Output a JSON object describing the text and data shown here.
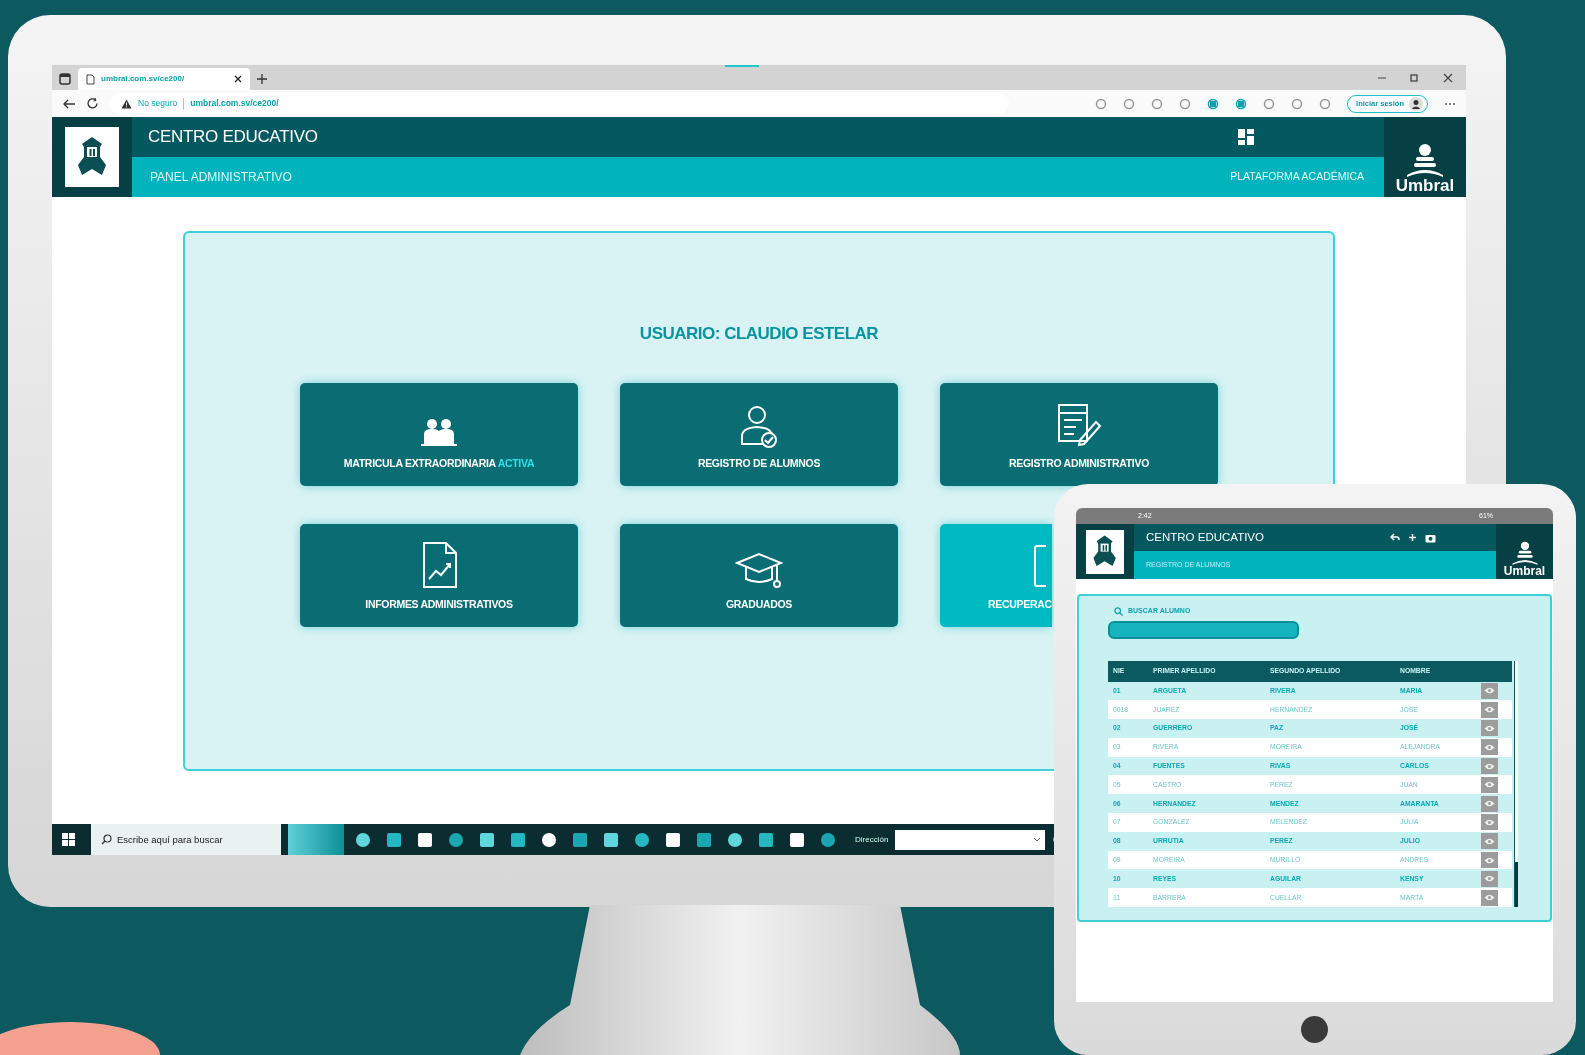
{
  "browser": {
    "tab_title": "umbral.com.sv/ce200/",
    "security": "No seguro",
    "url": "umbral.com.sv/ce200/",
    "sign_in": "Iniciar sesión"
  },
  "header": {
    "title": "CENTRO EDUCATIVO",
    "subtitle": "PANEL ADMINISTRATIVO",
    "platform": "PLATAFORMA ACADÉMICA",
    "brand": "Umbral"
  },
  "user": "USUARIO: CLAUDIO ESTELAR",
  "tiles": [
    {
      "kind": "people",
      "label": "MATRICULA EXTRAORDINARIA",
      "status": "ACTIVA",
      "highlighted": false,
      "clipped": false
    },
    {
      "kind": "user",
      "label": "REGISTRO DE ALUMNOS",
      "highlighted": false,
      "clipped": false
    },
    {
      "kind": "form",
      "label": "REGISTRO ADMINISTRATIVO",
      "highlighted": false,
      "clipped": false
    },
    {
      "kind": "report",
      "label": "INFORMES ADMINISTRATIVOS",
      "highlighted": false,
      "clipped": false
    },
    {
      "kind": "graduation",
      "label": "GRADUADOS",
      "highlighted": false,
      "clipped": false
    },
    {
      "kind": "document",
      "label": "RECUPERAC",
      "highlighted": true,
      "clipped": true
    }
  ],
  "taskbar": {
    "search": {
      "placeholder": "Escribe aquí para buscar"
    },
    "address_label": "Dirección"
  },
  "tablet": {
    "status_time": "2:42",
    "battery": "61%",
    "title": "CENTRO EDUCATIVO",
    "subtitle": "REGISTRO DE ALUMNOS",
    "brand": "Umbral",
    "search_label": "BUSCAR ALUMNO",
    "table": {
      "columns": [
        "NIE",
        "PRIMER APELLIDO",
        "SEGUNDO APELLIDO",
        "NOMBRE"
      ],
      "rows": [
        [
          "01",
          "ARGUETA",
          "RIVERA",
          "MARIA"
        ],
        [
          "0018",
          "JUAREZ",
          "HERNANDEZ",
          "JOSE"
        ],
        [
          "02",
          "GUERRERO",
          "PAZ",
          "JOSÉ"
        ],
        [
          "03",
          "RIVERA",
          "MOREIRA",
          "ALEJANDRA"
        ],
        [
          "04",
          "FUENTES",
          "RIVAS",
          "CARLOS"
        ],
        [
          "05",
          "CASTRO",
          "PEREZ",
          "JUAN"
        ],
        [
          "06",
          "HERNANDEZ",
          "MENDEZ",
          "AMARANTA"
        ],
        [
          "07",
          "GONZALEZ",
          "MELENDEZ",
          "JULIA"
        ],
        [
          "08",
          "URRUTIA",
          "PEREZ",
          "JULIO"
        ],
        [
          "09",
          "MOREIRA",
          "MURILLO",
          "ANDRES"
        ],
        [
          "10",
          "REYES",
          "AGUILAR",
          "KENSY"
        ],
        [
          "11",
          "BARRERA",
          "CUELLAR",
          "MARTA"
        ]
      ]
    }
  }
}
